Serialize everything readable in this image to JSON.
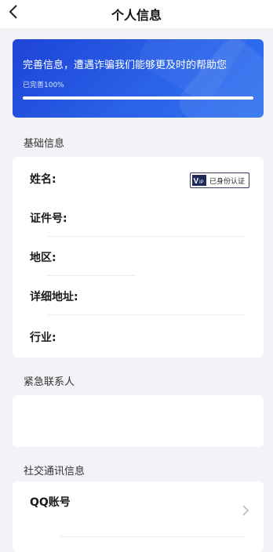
{
  "header": {
    "title": "个人信息"
  },
  "banner": {
    "text": "完善信息，遭遇诈骗我们能够更及时的帮助您",
    "progress_label": "已完善100%",
    "progress": 1.0
  },
  "basic": {
    "section_title": "基础信息",
    "name_label": "姓名:",
    "verified_badge": "已身份认证",
    "id_label": "证件号:",
    "region_label": "地区:",
    "address_label": "详细地址:",
    "industry_label": "行业:"
  },
  "emergency": {
    "section_title": "紧急联系人"
  },
  "social": {
    "section_title": "社交通讯信息",
    "qq_label": "QQ账号"
  },
  "colors": {
    "banner_start": "#1e44d6",
    "banner_end": "#2f72f0",
    "page_bg": "#f1f3f6"
  }
}
